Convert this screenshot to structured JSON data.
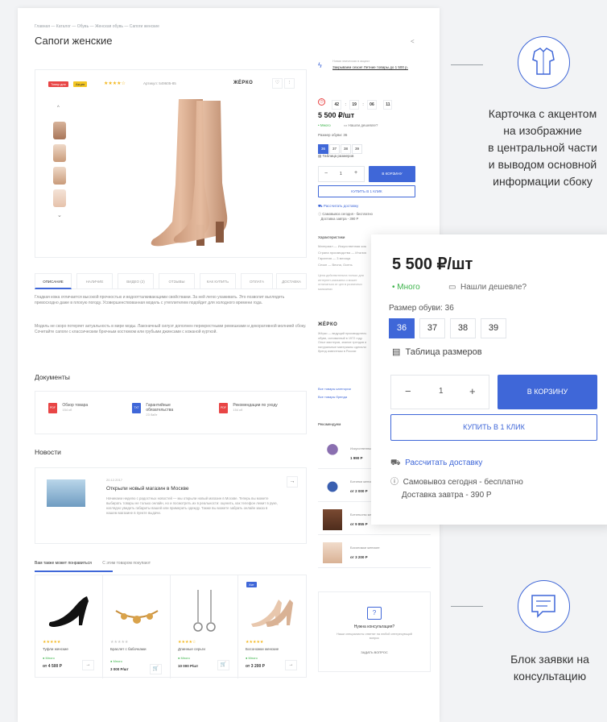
{
  "breadcrumb": "Главная  —  Каталог  —  Обувь  —  Женская обувь  —  Сапоги женские",
  "page_title": "Сапоги женские",
  "gallery": {
    "badge_sale": "Товар дня",
    "badge_promo": "Акция",
    "stars": "★★★★☆",
    "article": "Артикул: 549605-85",
    "brand": "ЖЁРКО"
  },
  "side": {
    "promo_label": "Новая эпическая в акциях",
    "promo_text": "Закрываем сезон! Летние товары до 1 500 р.",
    "timer": [
      "42",
      "19",
      "06",
      "11"
    ],
    "price": "5 500 ₽/шт",
    "avail": "• Много",
    "cheaper": "Нашли дешевле?",
    "size_label": "Размер обуви: 36",
    "sizes": [
      "36",
      "37",
      "38",
      "39"
    ],
    "size_table": "Таблица размеров",
    "qty": "1",
    "cart": "В КОРЗИНУ",
    "one_click": "КУПИТЬ В 1 КЛИК",
    "delivery_calc": "Рассчитать доставку",
    "pickup": "Самовывоз сегодня - бесплатно",
    "delivery_tomorrow": "Доставка завтра - 390 Р",
    "chars_title": "Характеристики",
    "chars": [
      "Материал — Искусственная кожа",
      "Страна производства — Италия",
      "Гарантия — 3 месяца",
      "Сезон — Весна, Осень"
    ],
    "chars_note": "Цена действительна только для интернет-магазина и может отличаться от цен в розничных магазинах",
    "brand_block_name": "ЖЁРКО",
    "brand_block_text": "Жёрко — ведущий производитель обуви, основанный в 1972 году. Опыт мастеров, знание трендов и натуральные материалы сделали бренд известным в России",
    "brand_link_all": "Все товары категории",
    "brand_link_brand": "Все товары бренда",
    "rec_title": "Рекомендуем",
    "recs": [
      {
        "name": "Искусственные цветы",
        "price": "1 990 Р"
      },
      {
        "name": "Ботинки женские зимние",
        "price": "от 2 000 Р"
      },
      {
        "name": "Ботильоны женские",
        "price": "от 9 855 Р"
      },
      {
        "name": "Босоножки женские",
        "price": "от 3 200 Р"
      }
    ],
    "consult_title": "Нужна консультация?",
    "consult_text": "Наши специалисты ответят на любой интересующий вопрос",
    "consult_btn": "ЗАДАТЬ ВОПРОС"
  },
  "tabs": [
    "ОПИСАНИЕ",
    "НАЛИЧИЕ",
    "ВИДЕО (2)",
    "ОТЗЫВЫ",
    "КАК КУПИТЬ",
    "ОПЛАТА",
    "ДОСТАВКА"
  ],
  "description": [
    "Гладкая кожа отличается высокой прочностью и водоотталкивающими свойствами. За ней легко ухаживать. Это позволит выглядеть превосходно даже в плохую погоду. Усовершенствованная модель с утеплителем подойдет для холодного времени года.",
    "Модель не скоро потеряет актуальность в мире моды. Лаконичный силуэт дополнен перекрестными ремешками и декоративной молнией сбоку. Сочетайте сапоги с классическим брючным костюмом или грубыми джинсами с кожаной курткой."
  ],
  "documents": {
    "title": "Документы",
    "items": [
      {
        "name": "Обзор товара",
        "size": "154 кб",
        "type": "PDF"
      },
      {
        "name": "Гарантийные обязательства",
        "size": "23 байт",
        "type": "TXT"
      },
      {
        "name": "Рекомендации по уходу",
        "size": "154 кб",
        "type": "PDF"
      }
    ]
  },
  "news": {
    "title": "Новости",
    "date": "20.12.2017",
    "headline": "Открыли новый магазин в Москве",
    "text": "Начинаем неделю с радостных новостей — мы открыли новый магазин в Москве. Теперь вы можете выбирать товары не только онлайн, но и посмотреть их в реальности: оценить, как телефон лежит в руке, наглядно увидеть габариты вашей или примерить одежду. Также вы можете забрать онлайн заказ в нашем магазине в пункте выдачи."
  },
  "product_tabs": [
    "Вам также может понравиться",
    "С этим товаром покупают"
  ],
  "products": [
    {
      "name": "Туфли женские",
      "avail": "● Много",
      "price": "от 4 500 Р"
    },
    {
      "name": "Браслет с бабочками",
      "avail": "● Много",
      "price": "3 000 Р/шт"
    },
    {
      "name": "Длинные серьги",
      "avail": "● Много",
      "price": "10 000 Р/шт"
    },
    {
      "name": "Босоножки женские",
      "avail": "● Много",
      "price": "от 3 200 Р"
    }
  ],
  "product_badge": "Хит",
  "zoom": {
    "price": "5 500 ₽/шт",
    "avail": "• Много",
    "cheaper": "Нашли дешевле?",
    "size_label": "Размер обуви: 36",
    "sizes": [
      "36",
      "37",
      "38",
      "39"
    ],
    "size_table": "Таблица размеров",
    "qty": "1",
    "cart": "В КОРЗИНУ",
    "one_click": "КУПИТЬ В 1 КЛИК",
    "delivery_calc": "Рассчитать доставку",
    "pickup": "Самовывоз сегодня - бесплатно",
    "delivery_tomorrow": "Доставка завтра - 390 Р"
  },
  "callouts": {
    "card_lines": [
      "Карточка с акцентом",
      "на изображние",
      "в центральной части",
      "и выводом основной",
      "информации сбоку"
    ],
    "consult_lines": [
      "Блок заявки на",
      "консультацию"
    ]
  },
  "colors": {
    "accent": "#3f67d8",
    "green": "#3cb34a",
    "red": "#e84545",
    "yellow": "#f3c623",
    "star": "#f3b71f"
  }
}
